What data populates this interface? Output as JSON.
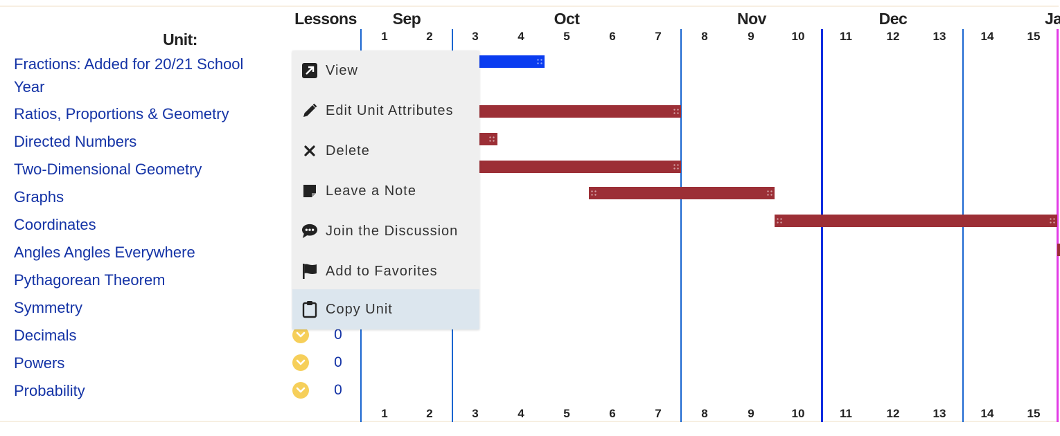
{
  "header": {
    "unit_label": "Unit:",
    "lessons_label": "Lessons"
  },
  "months": [
    {
      "name": "Sep"
    },
    {
      "name": "Oct"
    },
    {
      "name": "Nov"
    },
    {
      "name": "Dec"
    },
    {
      "name": "Ja"
    }
  ],
  "weeks": [
    "1",
    "2",
    "3",
    "4",
    "5",
    "6",
    "7",
    "8",
    "9",
    "10",
    "11",
    "12",
    "13",
    "14",
    "15"
  ],
  "units": [
    {
      "name": "Fractions: Added for 20/21 School Year",
      "lessons": ""
    },
    {
      "name": "Ratios, Proportions & Geometry",
      "lessons": ""
    },
    {
      "name": "Directed Numbers",
      "lessons": ""
    },
    {
      "name": "Two-Dimensional Geometry",
      "lessons": ""
    },
    {
      "name": "Graphs",
      "lessons": ""
    },
    {
      "name": "Coordinates",
      "lessons": ""
    },
    {
      "name": "Angles Angles Everywhere",
      "lessons": ""
    },
    {
      "name": "Pythagorean Theorem",
      "lessons": ""
    },
    {
      "name": "Symmetry",
      "lessons": ""
    },
    {
      "name": "Decimals",
      "lessons": "0"
    },
    {
      "name": "Powers",
      "lessons": "0"
    },
    {
      "name": "Probability",
      "lessons": "0"
    }
  ],
  "context_menu": {
    "items": [
      {
        "label": "View",
        "icon": "external-link-icon"
      },
      {
        "label": "Edit Unit Attributes",
        "icon": "pencil-icon"
      },
      {
        "label": "Delete",
        "icon": "x-icon"
      },
      {
        "label": "Leave a Note",
        "icon": "note-icon"
      },
      {
        "label": "Join the Discussion",
        "icon": "chat-bubble-icon"
      },
      {
        "label": "Add to Favorites",
        "icon": "flag-icon"
      },
      {
        "label": "Copy Unit",
        "icon": "clipboard-icon"
      }
    ],
    "highlighted_item": "Copy Unit"
  },
  "colors": {
    "link": "#1433a6",
    "bar_red": "#9c2f36",
    "bar_blue": "#0a3cf0",
    "today_line": "#e23ce6",
    "lesson_icon": "#f6cf5a"
  }
}
